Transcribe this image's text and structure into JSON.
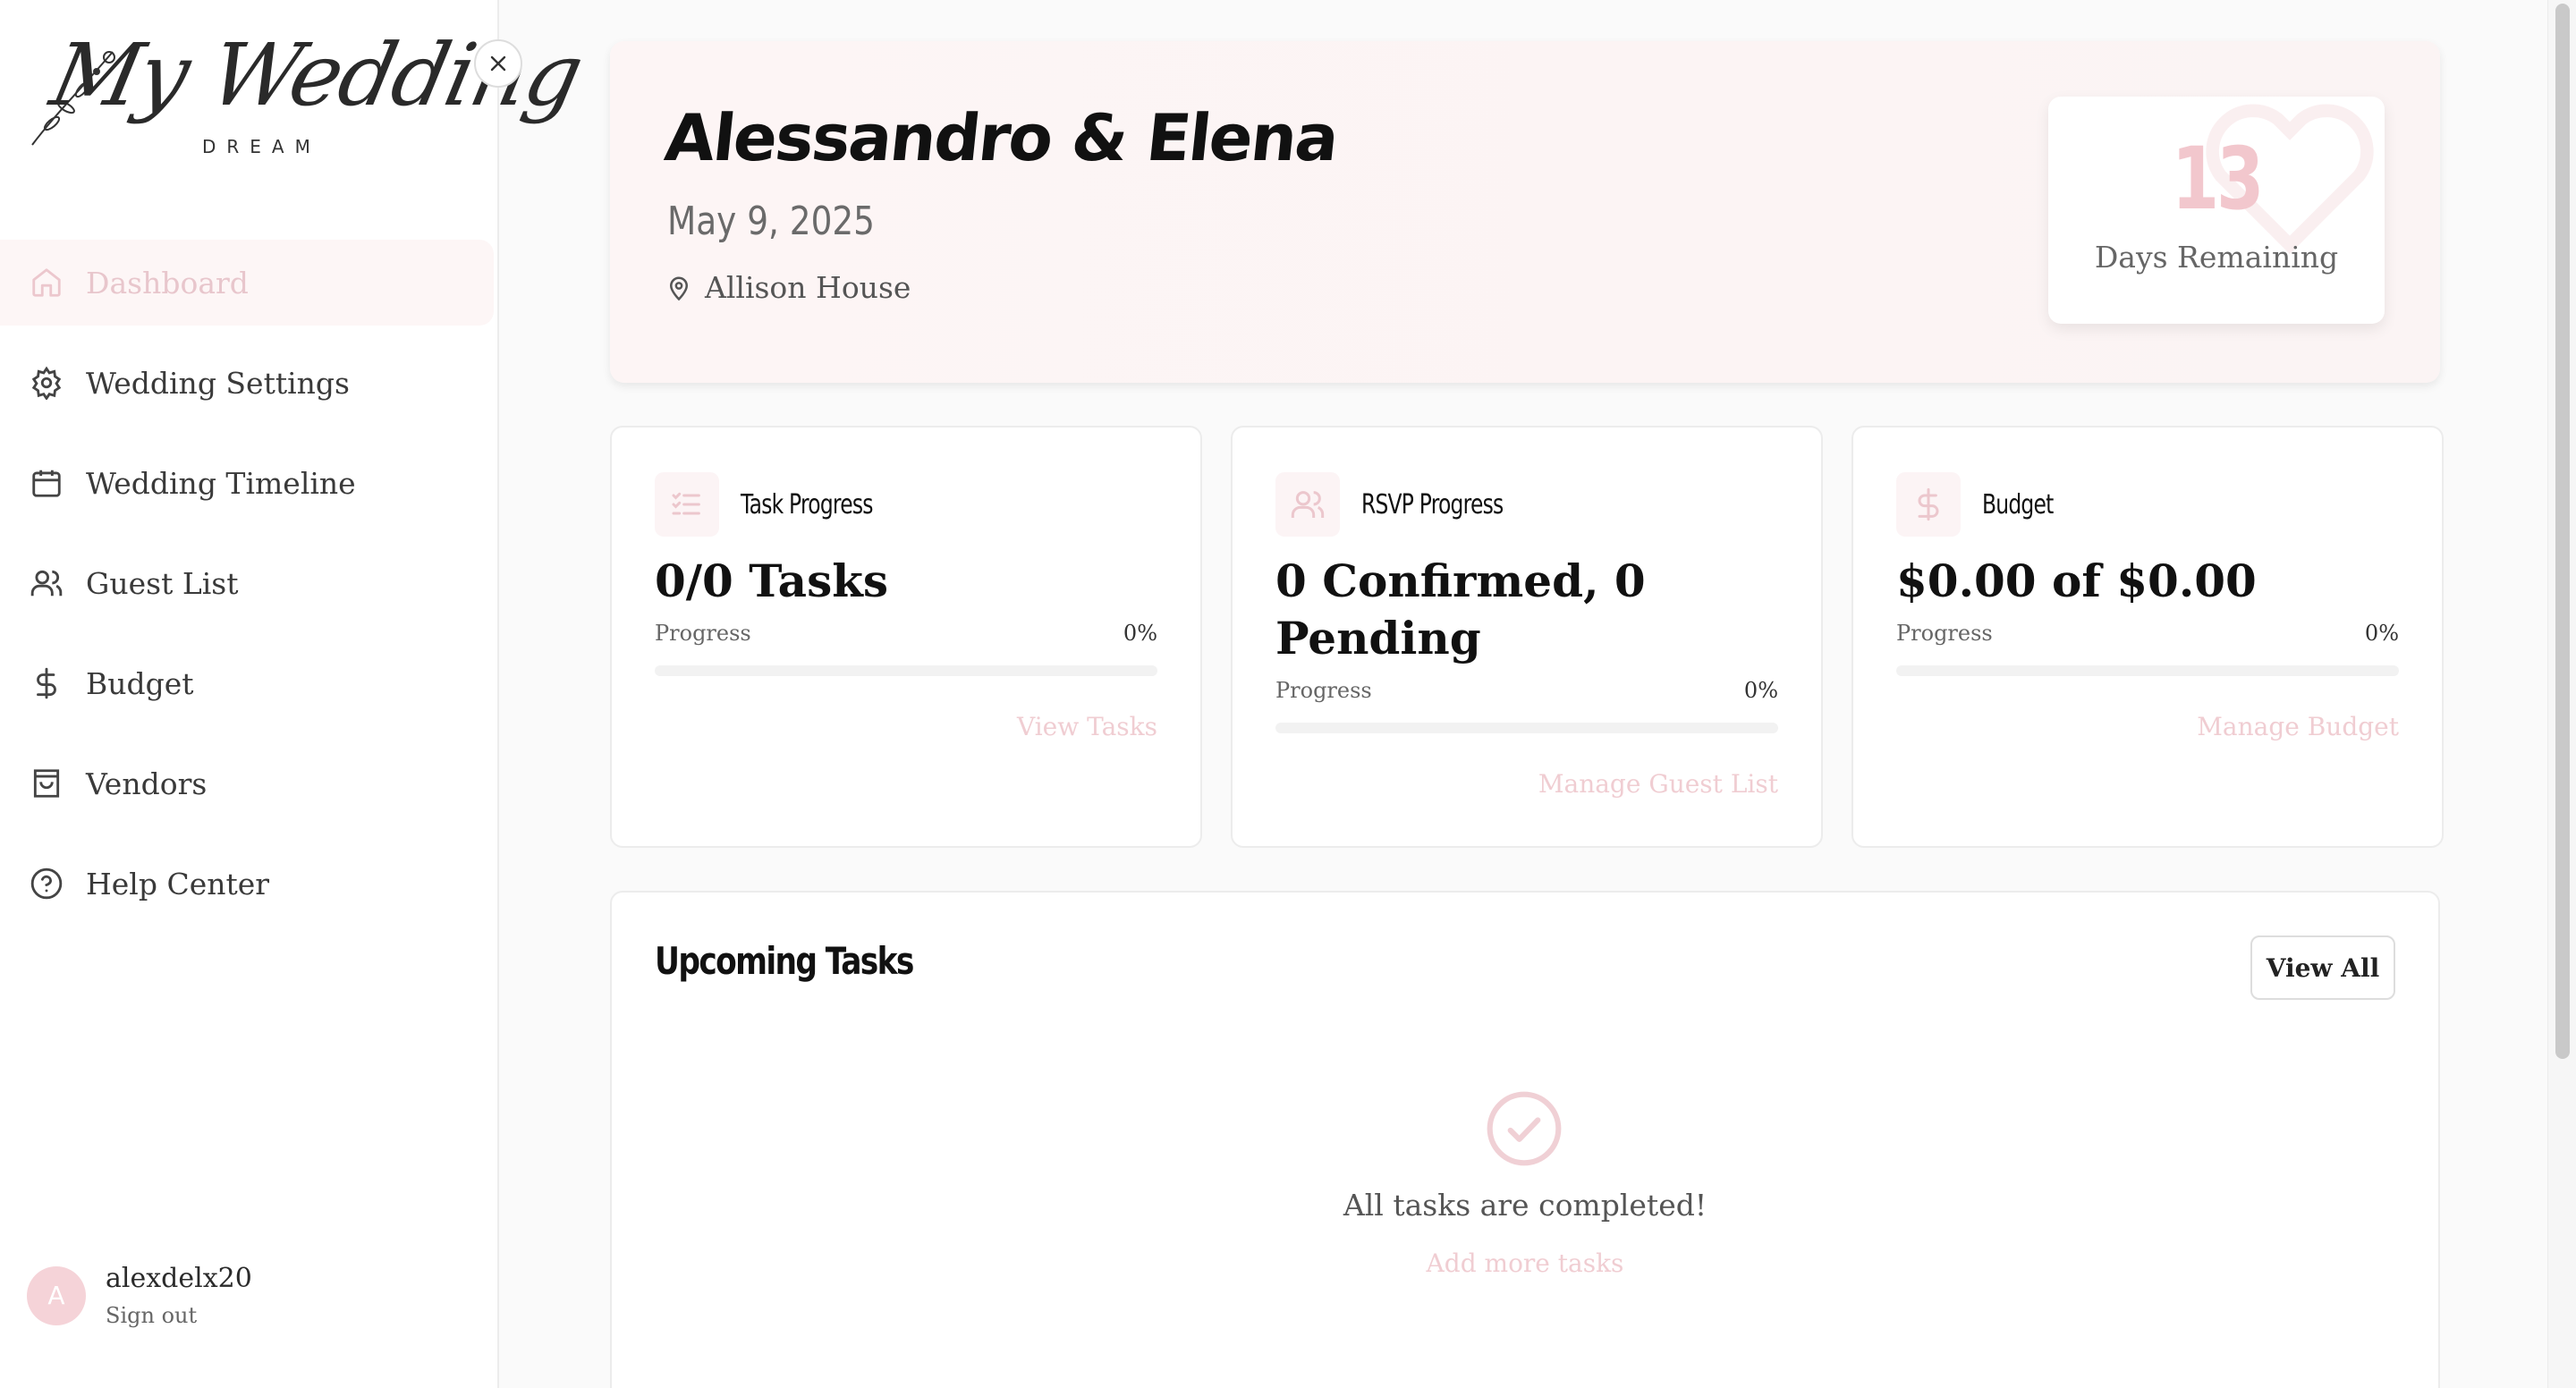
{
  "logo": {
    "script": "My Wedding",
    "sub": "DREAM"
  },
  "sidebar": {
    "items": [
      {
        "label": "Dashboard",
        "icon": "home-icon",
        "active": true
      },
      {
        "label": "Wedding Settings",
        "icon": "gear-icon"
      },
      {
        "label": "Wedding Timeline",
        "icon": "calendar-icon"
      },
      {
        "label": "Guest List",
        "icon": "users-icon"
      },
      {
        "label": "Budget",
        "icon": "dollar-icon"
      },
      {
        "label": "Vendors",
        "icon": "shopping-bag-icon"
      },
      {
        "label": "Help Center",
        "icon": "help-circle-icon"
      }
    ]
  },
  "user": {
    "initial": "A",
    "name": "alexdelx20",
    "sign_out": "Sign out"
  },
  "hero": {
    "couple": "Alessandro & Elena",
    "date": "May 9, 2025",
    "venue": "Allison House",
    "days_remaining": "13",
    "days_label": "Days Remaining"
  },
  "cards": [
    {
      "title": "Task Progress",
      "icon": "checklist-icon",
      "value": "0/0 Tasks",
      "progress_label": "Progress",
      "progress_pct": "0%",
      "progress": 0,
      "link": "View Tasks"
    },
    {
      "title": "RSVP Progress",
      "icon": "users-icon",
      "value": "0 Confirmed, 0 Pending",
      "progress_label": "Progress",
      "progress_pct": "0%",
      "progress": 0,
      "link": "Manage Guest List"
    },
    {
      "title": "Budget",
      "icon": "dollar-icon",
      "value": "$0.00 of $0.00",
      "progress_label": "Progress",
      "progress_pct": "0%",
      "progress": 0,
      "link": "Manage Budget"
    }
  ],
  "upcoming": {
    "title": "Upcoming Tasks",
    "view_all": "View All",
    "empty_text": "All tasks are completed!",
    "empty_link": "Add more tasks"
  },
  "colors": {
    "accent": "#f2c7cd",
    "accent_light": "#fdf6f6",
    "text": "#222222"
  }
}
